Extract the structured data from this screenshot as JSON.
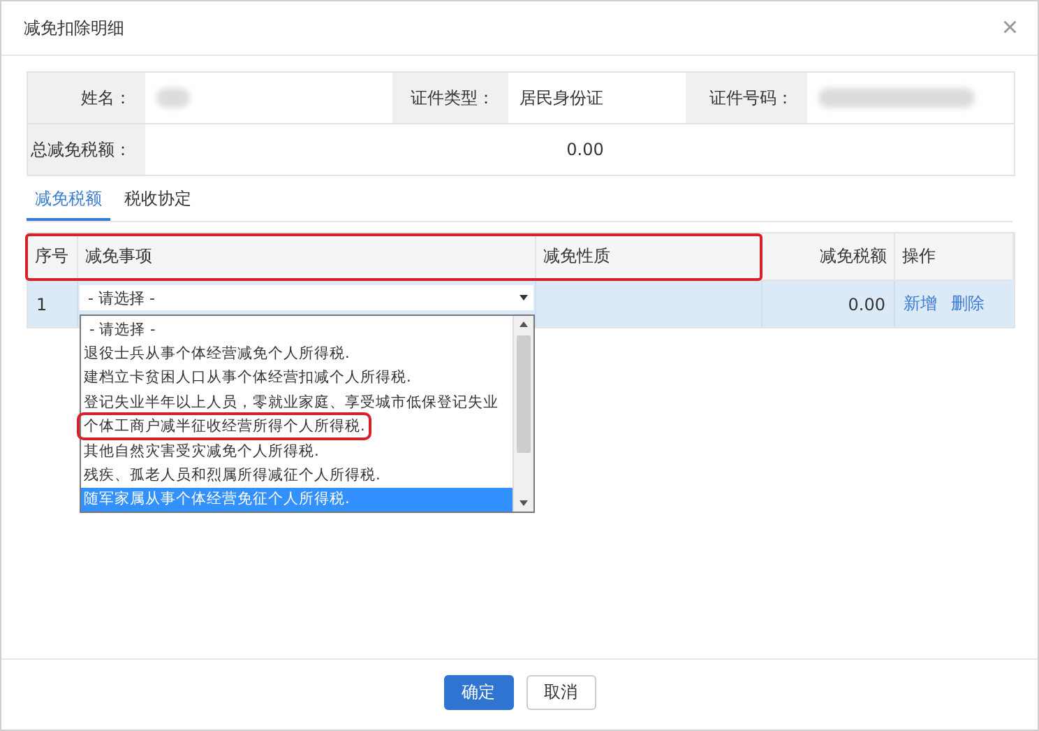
{
  "window": {
    "title": "减免扣除明细",
    "close": "×"
  },
  "info": {
    "rows": [
      {
        "cells": [
          {
            "label": "姓名：",
            "redacted": true
          },
          {
            "label": "证件类型：",
            "value": "居民身份证"
          },
          {
            "label": "证件号码：",
            "redacted": true
          }
        ]
      },
      {
        "cells": [
          {
            "label": "总减免税额：",
            "value": "0.00"
          }
        ]
      }
    ]
  },
  "tabs": [
    {
      "label": "减免税额",
      "selected": true
    },
    {
      "label": "税收协定",
      "selected": false
    }
  ],
  "table": {
    "header_annotated": true,
    "columns": [
      {
        "label": "序号",
        "kind": "text"
      },
      {
        "label": "减免事项",
        "kind": "text"
      },
      {
        "label": "减免性质",
        "kind": "text"
      },
      {
        "label": "减免税额",
        "kind": "number"
      },
      {
        "label": "操作",
        "kind": "text"
      }
    ],
    "rows": [
      {
        "index": "1",
        "select": {
          "value": "- 请选择 -",
          "open": true
        },
        "nature": "",
        "amount": "0.00",
        "actions": [
          "新增",
          "删除"
        ],
        "selected": true
      }
    ]
  },
  "dropdown": {
    "options": [
      {
        "label": "- 请选择 -",
        "selected": false,
        "annotated": false
      },
      {
        "label": "退役士兵从事个体经营减免个人所得税.",
        "selected": false,
        "annotated": false
      },
      {
        "label": "建档立卡贫困人口从事个体经营扣减个人所得税.",
        "selected": false,
        "annotated": false
      },
      {
        "label": "登记失业半年以上人员，零就业家庭、享受城市低保登记失业",
        "selected": false,
        "annotated": false
      },
      {
        "label": "个体工商户减半征收经营所得个人所得税.",
        "selected": false,
        "annotated": true
      },
      {
        "label": "其他自然灾害受灾减免个人所得税.",
        "selected": false,
        "annotated": false
      },
      {
        "label": "残疾、孤老人员和烈属所得减征个人所得税.",
        "selected": false,
        "annotated": false
      },
      {
        "label": "随军家属从事个体经营免征个人所得税.",
        "selected": true,
        "annotated": false
      }
    ]
  },
  "buttons": [
    {
      "label": "确定",
      "kind": "primary"
    },
    {
      "label": "取消",
      "kind": "default"
    }
  ]
}
